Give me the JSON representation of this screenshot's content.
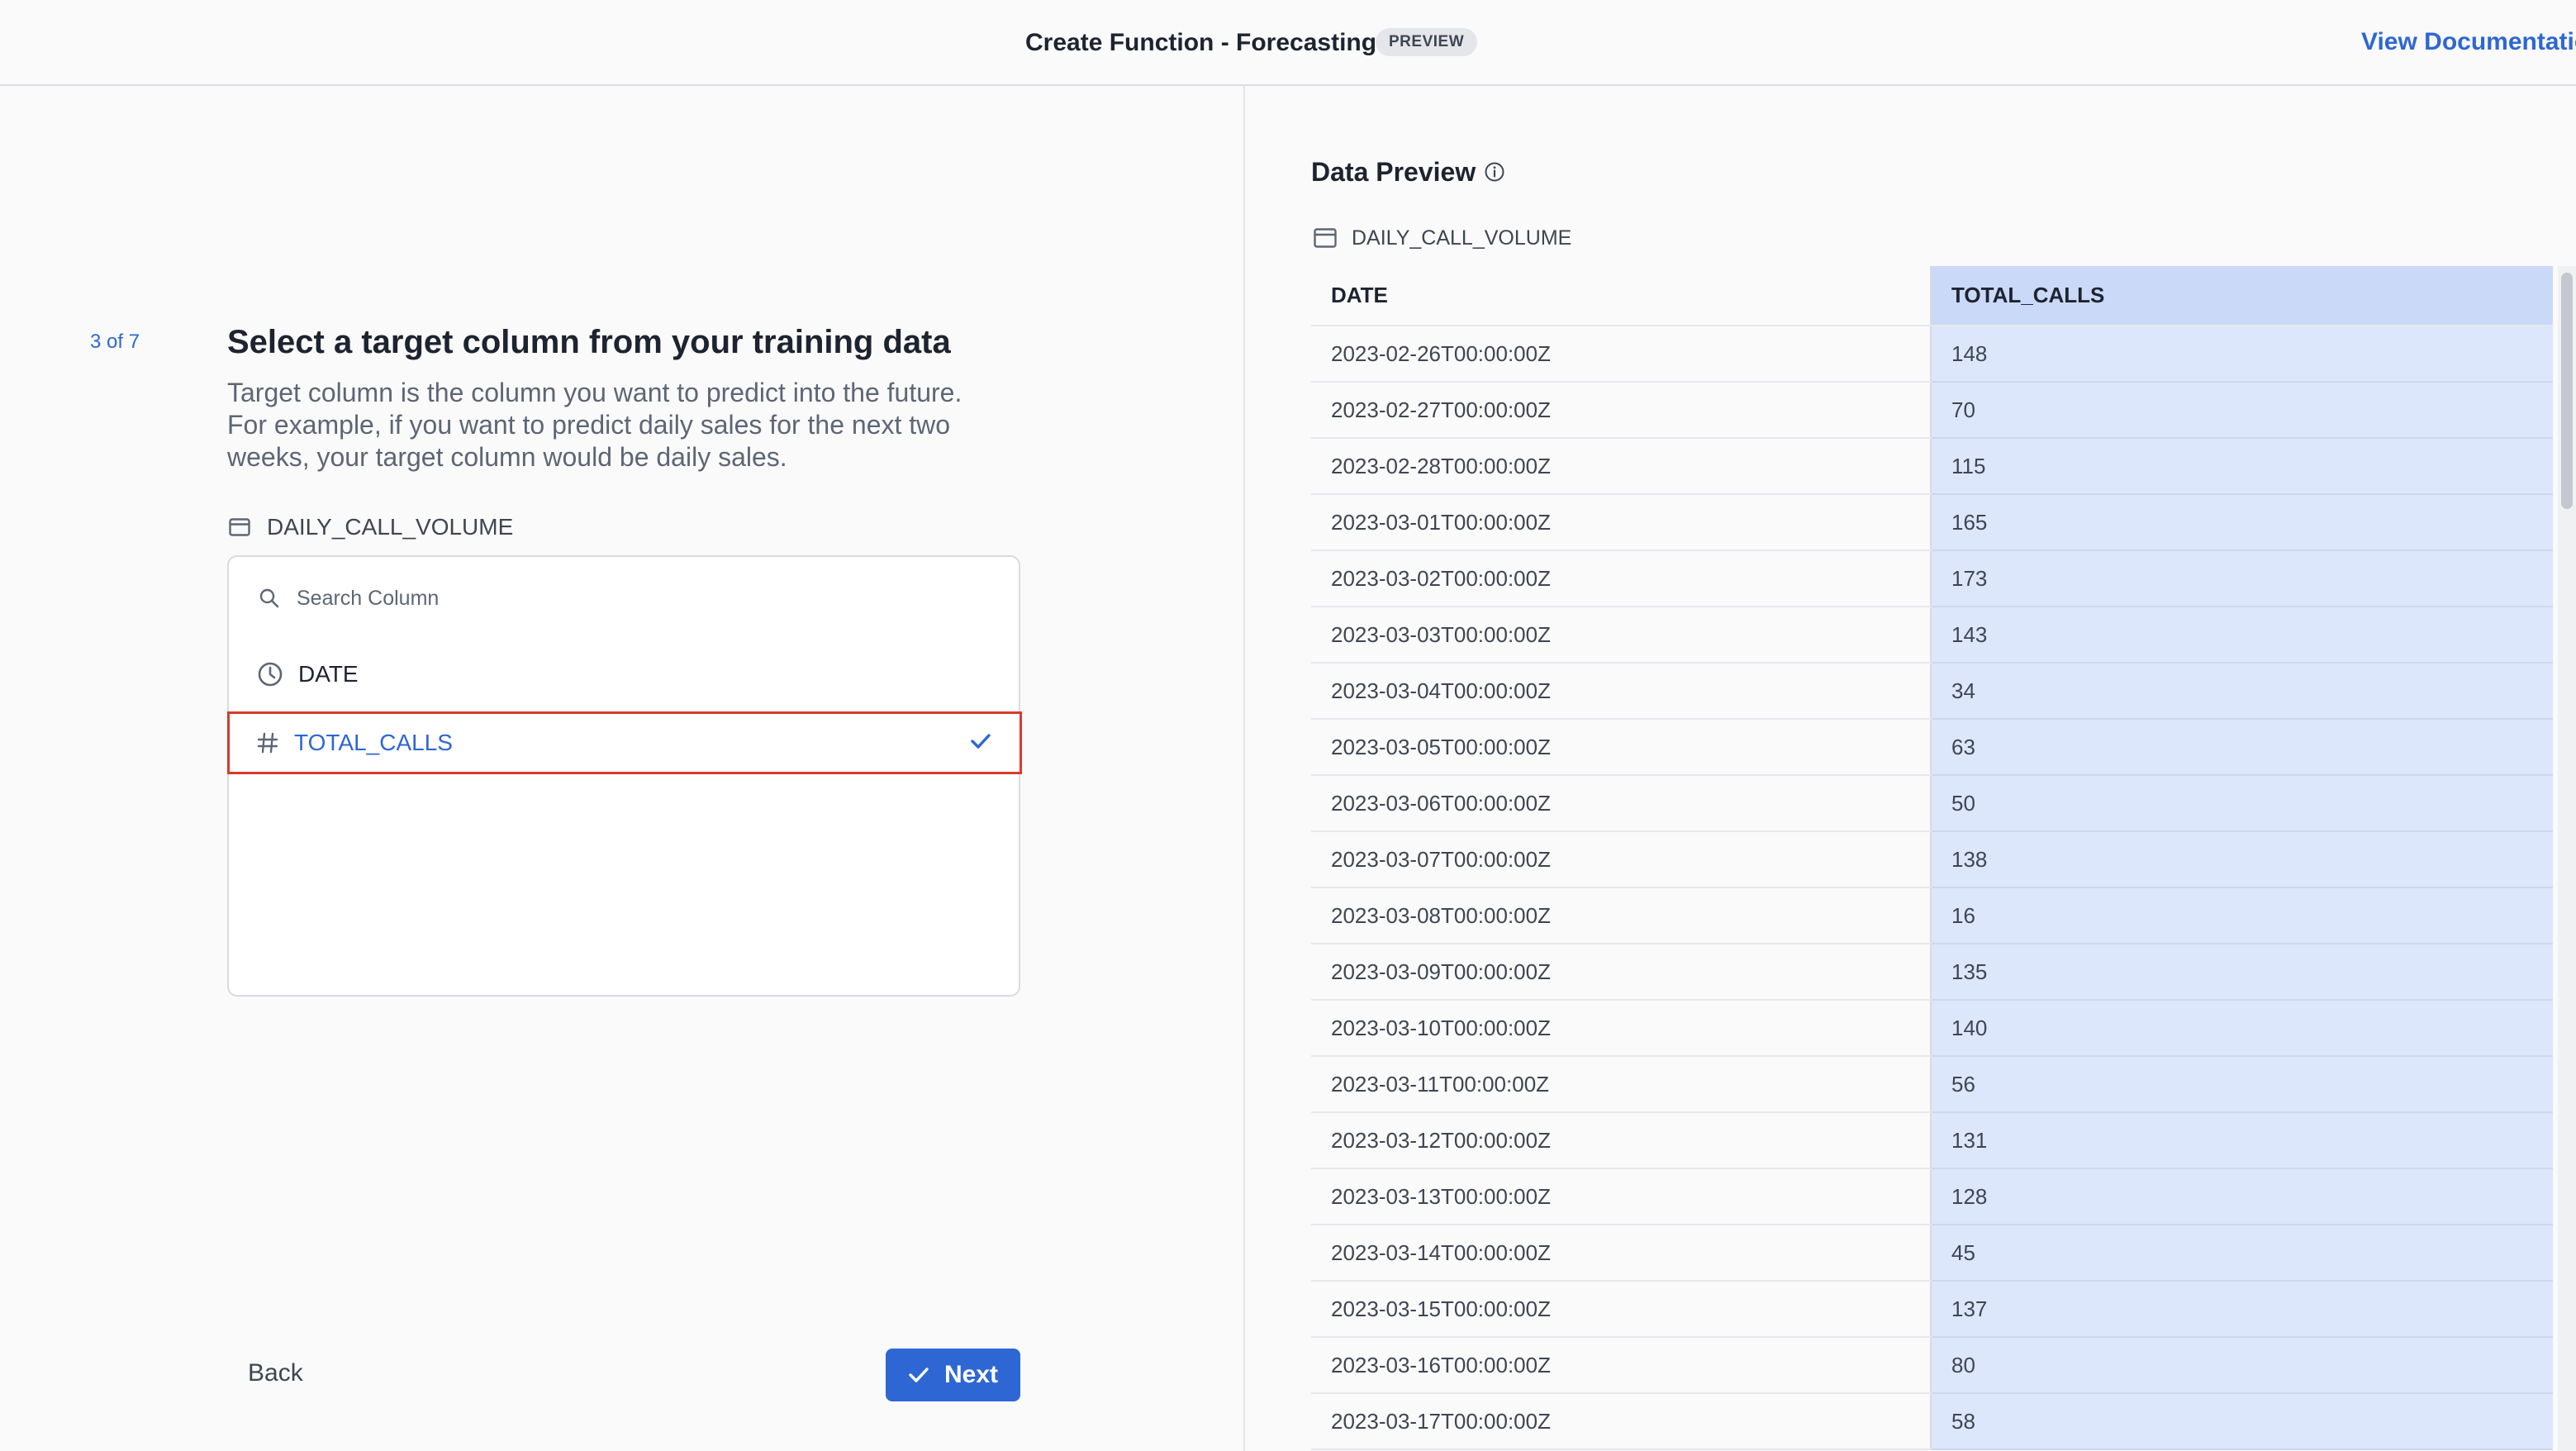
{
  "header": {
    "title": "Create Function - Forecasting",
    "badge": "PREVIEW",
    "docs_link": "View Documentation"
  },
  "wizard": {
    "step": "3 of 7",
    "title": "Select a target column from your training data",
    "description": "Target column is the column you want to predict into the future. For example, if you want to predict daily sales for the next two weeks, your target column would be daily sales.",
    "dataset": "DAILY_CALL_VOLUME",
    "search_placeholder": "Search Column",
    "columns": [
      {
        "name": "DATE",
        "icon": "clock-icon",
        "selected": false
      },
      {
        "name": "TOTAL_CALLS",
        "icon": "hash-icon",
        "selected": true
      }
    ],
    "back_label": "Back",
    "next_label": "Next"
  },
  "data_preview": {
    "title": "Data Preview",
    "dataset": "DAILY_CALL_VOLUME",
    "headers": [
      "DATE",
      "TOTAL_CALLS"
    ],
    "rows": [
      [
        "2023-02-26T00:00:00Z",
        "148"
      ],
      [
        "2023-02-27T00:00:00Z",
        "70"
      ],
      [
        "2023-02-28T00:00:00Z",
        "115"
      ],
      [
        "2023-03-01T00:00:00Z",
        "165"
      ],
      [
        "2023-03-02T00:00:00Z",
        "173"
      ],
      [
        "2023-03-03T00:00:00Z",
        "143"
      ],
      [
        "2023-03-04T00:00:00Z",
        "34"
      ],
      [
        "2023-03-05T00:00:00Z",
        "63"
      ],
      [
        "2023-03-06T00:00:00Z",
        "50"
      ],
      [
        "2023-03-07T00:00:00Z",
        "138"
      ],
      [
        "2023-03-08T00:00:00Z",
        "16"
      ],
      [
        "2023-03-09T00:00:00Z",
        "135"
      ],
      [
        "2023-03-10T00:00:00Z",
        "140"
      ],
      [
        "2023-03-11T00:00:00Z",
        "56"
      ],
      [
        "2023-03-12T00:00:00Z",
        "131"
      ],
      [
        "2023-03-13T00:00:00Z",
        "128"
      ],
      [
        "2023-03-14T00:00:00Z",
        "45"
      ],
      [
        "2023-03-15T00:00:00Z",
        "137"
      ],
      [
        "2023-03-16T00:00:00Z",
        "80"
      ],
      [
        "2023-03-17T00:00:00Z",
        "58"
      ]
    ]
  },
  "colors": {
    "accent": "#2e67d3",
    "selection_border": "#d93a2b",
    "highlight_column": "#dde7fb"
  }
}
